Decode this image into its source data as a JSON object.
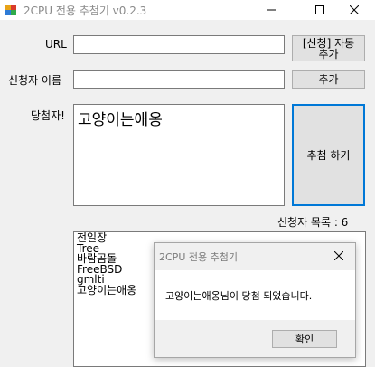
{
  "window": {
    "title": "2CPU 전용 추첨기 v0.2.3",
    "minimize_icon": "minimize-icon",
    "maximize_icon": "maximize-icon",
    "close_icon": "close-icon"
  },
  "form": {
    "url_label": "URL",
    "url_value": "",
    "auto_add_button_line1": "[신청] 자동",
    "auto_add_button_line2": "추가",
    "applicant_label": "신청자 이름",
    "applicant_value": "",
    "add_button": "추가",
    "winner_label": "당첨자!",
    "winner_value": "고양이는애옹",
    "draw_button": "추첨 하기",
    "applicant_count_label": "신청자 목록 : 6",
    "applicants": [
      "전일장",
      "Tree",
      "바람곰돌",
      "FreeBSD",
      "gmlti",
      "고양이는애옹"
    ]
  },
  "dialog": {
    "title": "2CPU 전용 추첨기",
    "message": "고양이는애옹님이 당첨 되었습니다.",
    "ok_button": "확인",
    "close_icon": "close-icon"
  },
  "colors": {
    "accent": "#0078d7",
    "window_bg": "#f0f0f0",
    "button_bg": "#e1e1e1"
  }
}
